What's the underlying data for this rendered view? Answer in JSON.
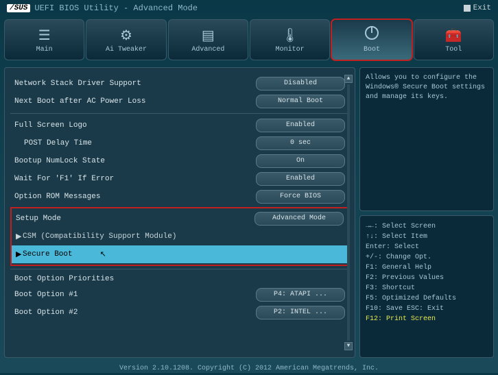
{
  "header": {
    "brand": "/SUS",
    "title": "UEFI BIOS Utility - Advanced Mode",
    "exit": "Exit"
  },
  "tabs": [
    {
      "label": "Main",
      "icon": "☰"
    },
    {
      "label": "Ai Tweaker",
      "icon": "⚙"
    },
    {
      "label": "Advanced",
      "icon": "▤"
    },
    {
      "label": "Monitor",
      "icon": "🌡"
    },
    {
      "label": "Boot",
      "icon": "⏻",
      "active": true,
      "highlighted": true
    },
    {
      "label": "Tool",
      "icon": "🧰"
    }
  ],
  "settings": {
    "group1": [
      {
        "label": "Network Stack Driver Support",
        "value": "Disabled"
      },
      {
        "label": "Next Boot after AC Power Loss",
        "value": "Normal Boot"
      }
    ],
    "group2": [
      {
        "label": "Full Screen Logo",
        "value": "Enabled"
      },
      {
        "label": "POST Delay Time",
        "value": "0 sec",
        "indent": true
      },
      {
        "label": "Bootup NumLock State",
        "value": "On"
      },
      {
        "label": "Wait For 'F1' If Error",
        "value": "Enabled"
      },
      {
        "label": "Option ROM Messages",
        "value": "Force BIOS"
      }
    ],
    "highlighted": {
      "setup_mode": {
        "label": "Setup Mode",
        "value": "Advanced Mode"
      },
      "csm": "CSM (Compatibility Support Module)",
      "secure_boot": "Secure Boot"
    },
    "boot_priorities": {
      "title": "Boot Option Priorities",
      "opt1": {
        "label": "Boot Option #1",
        "value": "P4: ATAPI ..."
      },
      "opt2": {
        "label": "Boot Option #2",
        "value": "P2: INTEL ..."
      }
    }
  },
  "help_text": "Allows you to configure the Windows® Secure Boot settings and manage its keys.",
  "keys": [
    "→←: Select Screen",
    "↑↓: Select Item",
    "Enter: Select",
    "+/-: Change Opt.",
    "F1: General Help",
    "F2: Previous Values",
    "F3: Shortcut",
    "F5: Optimized Defaults",
    "F10: Save  ESC: Exit"
  ],
  "key_highlight": "F12: Print Screen",
  "footer": "Version 2.10.1208. Copyright (C) 2012 American Megatrends, Inc."
}
